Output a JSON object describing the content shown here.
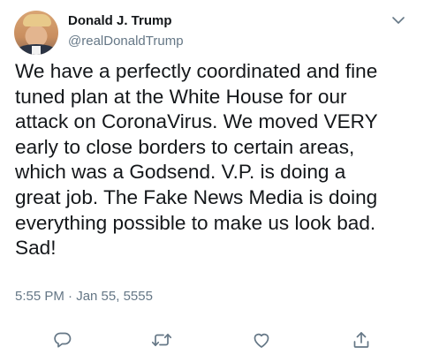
{
  "tweet": {
    "author_name": "Donald J. Trump",
    "author_handle": "@realDonaldTrump",
    "text": "We have a perfectly coordinated and fine\ntuned plan at the White House for our\nattack on CoronaVirus. We moved VERY\nearly to close borders to certain areas,\nwhich was a Godsend. V.P. is doing a\ngreat job. The Fake News Media is doing\neverything possible to make us look bad.\nSad!",
    "timestamp": "5:55 PM · Jan 55, 5555"
  },
  "icons": {
    "menu": "chevron-down-icon",
    "reply": "reply-icon",
    "retweet": "retweet-icon",
    "like": "heart-icon",
    "share": "share-icon"
  },
  "colors": {
    "text": "#14171a",
    "secondary": "#657786"
  }
}
